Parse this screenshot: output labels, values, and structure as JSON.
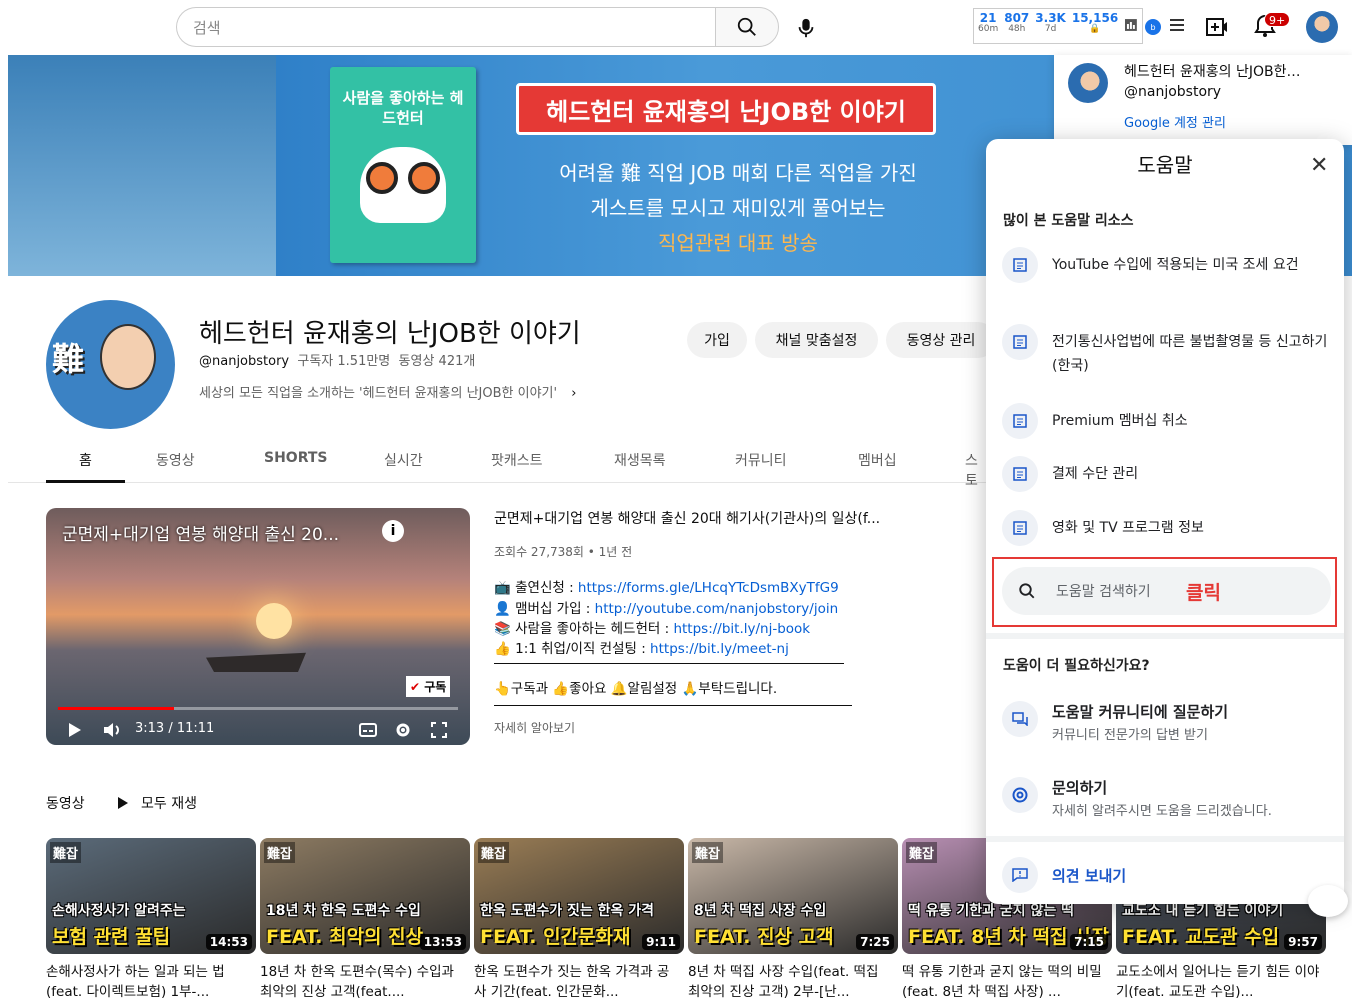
{
  "header": {
    "search_placeholder": "검색",
    "stats": [
      {
        "value": "21",
        "label": "60m"
      },
      {
        "value": "807",
        "label": "48h"
      },
      {
        "value": "3.3K",
        "label": "7d"
      },
      {
        "value": "15,156",
        "label": ""
      }
    ],
    "notification_badge": "9+"
  },
  "account": {
    "name": "헤드헌터 윤재홍의 난JOB한…",
    "handle": "@nanjobstory",
    "manage_label": "Google 계정 관리"
  },
  "banner": {
    "book_title": "사람을 좋아하는 헤드헌터",
    "ribbon": "헤드헌터 윤재홍의 난JOB한 이야기",
    "line1": "어려울 難 직업 JOB 매회 다른 직업을 가진",
    "line2": "게스트를 모시고 재미있게 풀어보는",
    "line3": "직업관련 대표 방송"
  },
  "channel": {
    "title": "헤드헌터 윤재홍의 난JOB한 이야기",
    "handle": "@nanjobstory",
    "subscribers": "구독자 1.51만명",
    "videos": "동영상 421개",
    "description": "세상의 모든 직업을 소개하는 '헤드헌터 윤재홍의 난JOB한 이야기'",
    "buttons": [
      "가입",
      "채널 맞춤설정",
      "동영상 관리"
    ]
  },
  "tabs": [
    "홈",
    "동영상",
    "SHORTS",
    "실시간",
    "팟캐스트",
    "재생목록",
    "커뮤니티",
    "멤버십",
    "스토"
  ],
  "featured": {
    "overlay_title": "군면제+대기업 연봉 해양대 출신 20...",
    "title": "군면제+대기업 연봉 해양대 출신 20대 해기사(기관사)의 일상(f...",
    "meta": "조회수 27,738회 • 1년 전",
    "time": "3:13 / 11:11",
    "progress": 0.29,
    "watermark": "구독",
    "lines": [
      {
        "emoji": "📺",
        "text": "출연신청 : ",
        "link": "https://forms.gle/LHcqYTcDsmBXyTfG9"
      },
      {
        "emoji": "👤",
        "text": "맴버십 가입 : ",
        "link": "http://youtube.com/nanjobstory/join"
      },
      {
        "emoji": "📚",
        "text": "사람을 좋아하는 헤드헌터 : ",
        "link": "https://bit.ly/nj-book"
      },
      {
        "emoji": "👍",
        "text": "1:1 취업/이직 컨설팅 : ",
        "link": "https://bit.ly/meet-nj"
      }
    ],
    "cta": "👆구독과 👍좋아요 🔔알림설정 🙏부탁드립니다.",
    "more": "자세히 알아보기"
  },
  "videos_section": {
    "title": "동영상",
    "play_all": "모두 재생",
    "items": [
      {
        "cap1": "손해사정사가 알려주는",
        "cap2": "보험 관련 꿀팁",
        "duration": "14:53",
        "title": "손해사정사가 하는 일과 되는 법(feat. 다이렉트보험) 1부-...",
        "bg": "#5b6b7a"
      },
      {
        "cap1": "18년 차 한옥 도편수 수입",
        "cap2": "FEAT. 최악의 진상",
        "duration": "13:53",
        "title": "18년 차 한옥 도편수(목수) 수입과 최악의 진상 고객(feat....",
        "bg": "#8d7b62"
      },
      {
        "cap1": "한옥 도편수가 짓는 한옥 가격",
        "cap2": "FEAT. 인간문화재",
        "duration": "9:11",
        "title": "한옥 도편수가 짓는 한옥 가격과 공사 기간(feat. 인간문화...",
        "bg": "#9a7d55"
      },
      {
        "cap1": "8년 차 떡집 사장 수입",
        "cap2": "FEAT. 진상 고객",
        "duration": "7:25",
        "title": "8년 차 떡집 사장 수입(feat. 떡집 최악의 진상 고객) 2부-[난...",
        "bg": "#c9b8a8"
      },
      {
        "cap1": "떡 유통 기한과 굳지 않는 떡",
        "cap2": "FEAT. 8년 차 떡집 사장",
        "duration": "7:15",
        "title": "떡 유통 기한과 굳지 않는 떡의 비밀(feat. 8년 차 떡집 사장) ...",
        "bg": "#b88fb3"
      },
      {
        "cap1": "교도소 내 듣기 힘든 이야기",
        "cap2": "FEAT. 교도관 수입",
        "duration": "9:57",
        "title": "교도소에서 일어나는 듣기 힘든 이야기(feat. 교도관 수입)...",
        "bg": "#4e5766"
      }
    ]
  },
  "help": {
    "title": "도움말",
    "section1": "많이 본 도움말 리소스",
    "items": [
      "YouTube 수입에 적용되는 미국 조세 요건",
      "전기통신사업법에 따른 불법촬영물 등 신고하기 (한국)",
      "Premium 멤버십 취소",
      "결제 수단 관리",
      "영화 및 TV 프로그램 정보"
    ],
    "search_placeholder": "도움말 검색하기",
    "click_label": "클릭",
    "section2": "도움이 더 필요하신가요?",
    "community_title": "도움말 커뮤니티에 질문하기",
    "community_sub": "커뮤니티 전문가의 답변 받기",
    "contact_title": "문의하기",
    "contact_sub": "자세히 알려주시면 도움을 드리겠습니다.",
    "feedback": "의견 보내기"
  }
}
